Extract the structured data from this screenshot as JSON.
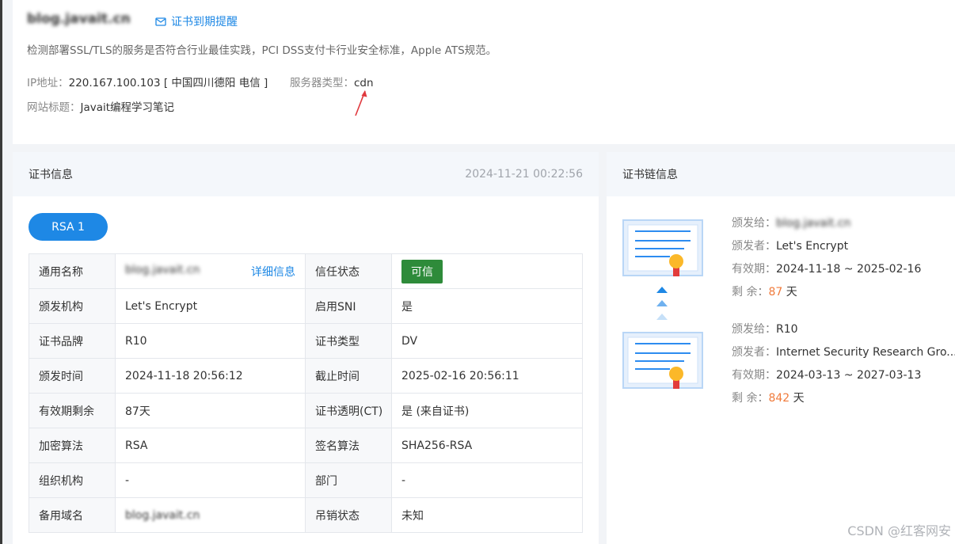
{
  "site": {
    "domain": "blog.javait.cn",
    "remind_label": "证书到期提醒",
    "description": "检测部署SSL/TLS的服务是否符合行业最佳实践，PCI DSS支付卡行业安全标准，Apple ATS规范。",
    "ip_label": "IP地址：",
    "ip_value": "220.167.100.103 [ 中国四川德阳 电信 ]",
    "server_type_label": "服务器类型：",
    "server_type_value": "cdn",
    "title_label": "网站标题：",
    "title_value": "Javait编程学习笔记"
  },
  "cert": {
    "panel_title": "证书信息",
    "timestamp": "2024-11-21 00:22:56",
    "tab_label": "RSA 1",
    "detail_link": "详细信息",
    "rows": [
      {
        "k1": "通用名称",
        "v1": "blog.javait.cn",
        "k2": "信任状态",
        "v2": "可信"
      },
      {
        "k1": "颁发机构",
        "v1": "Let's Encrypt",
        "k2": "启用SNI",
        "v2": "是"
      },
      {
        "k1": "证书品牌",
        "v1": "R10",
        "k2": "证书类型",
        "v2": "DV"
      },
      {
        "k1": "颁发时间",
        "v1": "2024-11-18 20:56:12",
        "k2": "截止时间",
        "v2": "2025-02-16 20:56:11"
      },
      {
        "k1": "有效期剩余",
        "v1": "87天",
        "k2": "证书透明(CT)",
        "v2": "是 (来自证书)"
      },
      {
        "k1": "加密算法",
        "v1": "RSA",
        "k2": "签名算法",
        "v2": "SHA256-RSA"
      },
      {
        "k1": "组织机构",
        "v1": "-",
        "k2": "部门",
        "v2": "-"
      },
      {
        "k1": "备用域名",
        "v1": "blog.javait.cn",
        "k2": "吊销状态",
        "v2": "未知"
      }
    ]
  },
  "chain": {
    "panel_title": "证书链信息",
    "issued_to_label": "颁发给：",
    "issuer_label": "颁发者：",
    "validity_label": "有效期：",
    "remaining_label": "剩 余：",
    "days_unit": "天",
    "items": [
      {
        "issued_to": "blog.javait.cn",
        "issuer": "Let's Encrypt",
        "validity": "2024-11-18 ~ 2025-02-16",
        "remaining": "87"
      },
      {
        "issued_to": "R10",
        "issuer": "Internet Security Research Gro...",
        "validity": "2024-03-13 ~ 2027-03-13",
        "remaining": "842"
      }
    ]
  },
  "watermark": "CSDN @红客网安",
  "colors": {
    "accent": "#1e88e5",
    "trusted": "#2e8b3a",
    "days": "#f07b3c",
    "arrow": "#e0393e"
  }
}
